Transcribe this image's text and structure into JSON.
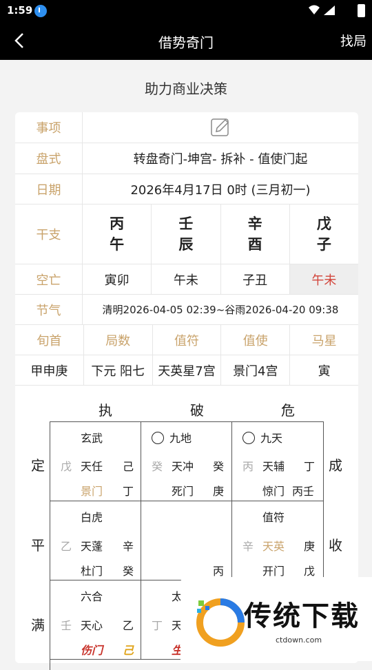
{
  "status": {
    "time": "1:59"
  },
  "appbar": {
    "title": "借势奇门",
    "right": "找局"
  },
  "subtitle": "助力商业决策",
  "info": {
    "shixiang_label": "事项",
    "panshi_label": "盘式",
    "panshi_value": "转盘奇门-坤宫- 拆补 - 值使门起",
    "riqi_label": "日期",
    "riqi_value": "2026年4月17日 0时 (三月初一)",
    "ganzhi_label": "干支",
    "ganzhi": [
      {
        "top": "丙",
        "bottom": "午"
      },
      {
        "top": "壬",
        "bottom": "辰"
      },
      {
        "top": "辛",
        "bottom": "酉"
      },
      {
        "top": "戊",
        "bottom": "子"
      }
    ],
    "kongwang_label": "空亡",
    "kongwang": [
      "寅卯",
      "午未",
      "子丑",
      "午未"
    ],
    "jieqi_label": "节气",
    "jieqi_value": "清明2026-04-05 02:39~谷雨2026-04-20 09:38",
    "headers": [
      "旬首",
      "局数",
      "值符",
      "值使",
      "马星"
    ],
    "values": [
      "甲申庚",
      "下元 阳七",
      "天英星7宫",
      "景门4宫",
      "寅"
    ]
  },
  "jianchu": {
    "top": [
      "执",
      "破",
      "危"
    ],
    "left": [
      "定",
      "平",
      "满"
    ],
    "right": [
      "成",
      "收"
    ]
  },
  "palaces": {
    "p1": {
      "god": "玄武",
      "left": "戊",
      "star": "天任",
      "r1": "己",
      "door": "景门",
      "r2": "丁"
    },
    "p2": {
      "god": "九地",
      "left": "癸",
      "star": "天冲",
      "r1": "癸",
      "door": "死门",
      "r2": "庚"
    },
    "p3": {
      "god": "九天",
      "left": "丙",
      "star": "天辅",
      "r1": "丁",
      "door": "惊门",
      "r2": "丙壬"
    },
    "p4": {
      "god": "白虎",
      "left": "乙",
      "star": "天蓬",
      "r1": "辛",
      "door": "杜门",
      "r2": "癸"
    },
    "p5": {
      "r2": "丙"
    },
    "p6": {
      "god": "值符",
      "left": "辛",
      "star": "天英",
      "r1": "庚",
      "door": "开门",
      "r2": "戊"
    },
    "p7": {
      "god": "六合",
      "left": "壬",
      "star": "天心",
      "r1": "乙",
      "door": "伤门",
      "r2": "己"
    },
    "p8": {
      "god": "太",
      "left": "丁",
      "star": "天",
      "door": "生"
    }
  },
  "watermark": {
    "text": "传统下载",
    "url": "ctdown.com"
  }
}
